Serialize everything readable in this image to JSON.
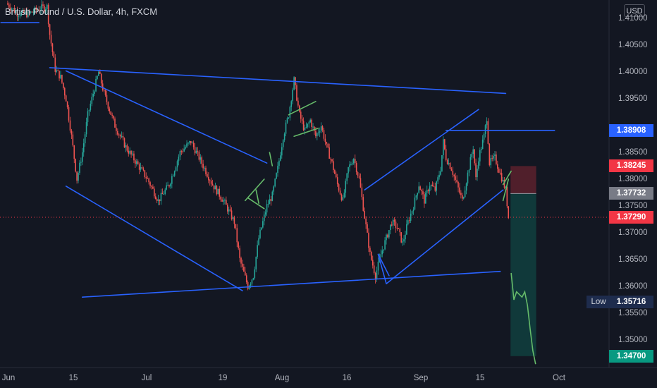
{
  "header": {
    "symbol_title": "British Pound / U.S. Dollar, 4h, FXCM",
    "currency_button": "USD"
  },
  "chart_data": {
    "type": "candlestick",
    "title": "British Pound / U.S. Dollar, 4h, FXCM",
    "x_tick_labels": [
      "Jun",
      "15",
      "Jul",
      "19",
      "Aug",
      "16",
      "Sep",
      "15",
      "Oct"
    ],
    "y_tick_labels": [
      "1.41000",
      "1.40500",
      "1.40000",
      "1.39500",
      "1.38500",
      "1.38000",
      "1.37500",
      "1.37000",
      "1.36500",
      "1.36000",
      "1.35500",
      "1.35000"
    ],
    "ylim": [
      1.3455,
      1.4135
    ],
    "grid": false,
    "price_labels": [
      {
        "id": "level",
        "value": "1.38908",
        "color": "#2962ff"
      },
      {
        "id": "stop",
        "value": "1.38245",
        "color": "#f23645"
      },
      {
        "id": "entry",
        "value": "1.37732",
        "color": "#787b86"
      },
      {
        "id": "last",
        "value": "1.37290",
        "color": "#f23645"
      },
      {
        "id": "low",
        "value": "1.35716",
        "color": "#1e2c4d",
        "tag": "Low"
      },
      {
        "id": "target",
        "value": "1.34700",
        "color": "#089981"
      }
    ],
    "price_path": [
      [
        0,
        1.4128
      ],
      [
        4,
        1.411
      ],
      [
        8,
        1.4108
      ],
      [
        12,
        1.4118
      ],
      [
        15,
        1.4122
      ],
      [
        16,
        1.407
      ],
      [
        18,
        1.4005
      ],
      [
        20,
        1.399
      ],
      [
        22,
        1.395
      ],
      [
        24,
        1.388
      ],
      [
        26,
        1.38
      ],
      [
        28,
        1.385
      ],
      [
        30,
        1.392
      ],
      [
        32,
        1.396
      ],
      [
        34,
        1.4
      ],
      [
        36,
        1.396
      ],
      [
        40,
        1.39
      ],
      [
        44,
        1.386
      ],
      [
        48,
        1.383
      ],
      [
        52,
        1.38
      ],
      [
        56,
        1.376
      ],
      [
        60,
        1.379
      ],
      [
        64,
        1.385
      ],
      [
        68,
        1.387
      ],
      [
        72,
        1.383
      ],
      [
        76,
        1.379
      ],
      [
        80,
        1.376
      ],
      [
        84,
        1.372
      ],
      [
        86,
        1.365
      ],
      [
        89,
        1.36
      ],
      [
        91,
        1.362
      ],
      [
        93,
        1.369
      ],
      [
        96,
        1.375
      ],
      [
        98,
        1.377
      ],
      [
        100,
        1.382
      ],
      [
        102,
        1.388
      ],
      [
        104,
        1.392
      ],
      [
        106,
        1.3985
      ],
      [
        108,
        1.392
      ],
      [
        110,
        1.389
      ],
      [
        112,
        1.391
      ],
      [
        114,
        1.388
      ],
      [
        116,
        1.39
      ],
      [
        118,
        1.386
      ],
      [
        120,
        1.383
      ],
      [
        122,
        1.379
      ],
      [
        124,
        1.376
      ],
      [
        126,
        1.382
      ],
      [
        128,
        1.384
      ],
      [
        130,
        1.38
      ],
      [
        132,
        1.373
      ],
      [
        134,
        1.366
      ],
      [
        136,
        1.362
      ],
      [
        138,
        1.366
      ],
      [
        140,
        1.369
      ],
      [
        142,
        1.372
      ],
      [
        144,
        1.371
      ],
      [
        146,
        1.368
      ],
      [
        148,
        1.372
      ],
      [
        150,
        1.375
      ],
      [
        152,
        1.379
      ],
      [
        154,
        1.376
      ],
      [
        156,
        1.379
      ],
      [
        158,
        1.378
      ],
      [
        160,
        1.382
      ],
      [
        161,
        1.387
      ],
      [
        162,
        1.384
      ],
      [
        164,
        1.382
      ],
      [
        166,
        1.379
      ],
      [
        168,
        1.376
      ],
      [
        170,
        1.381
      ],
      [
        172,
        1.386
      ],
      [
        173,
        1.38
      ],
      [
        174,
        1.384
      ],
      [
        176,
        1.388
      ],
      [
        177,
        1.3915
      ],
      [
        178,
        1.383
      ],
      [
        180,
        1.384
      ],
      [
        182,
        1.381
      ],
      [
        184,
        1.378
      ],
      [
        185,
        1.3729
      ]
    ],
    "projected_path": [
      [
        186,
        1.3625
      ],
      [
        187,
        1.3575
      ],
      [
        188,
        1.359
      ],
      [
        190,
        1.358
      ],
      [
        191,
        1.359
      ],
      [
        192,
        1.3565
      ],
      [
        193,
        1.352
      ],
      [
        194,
        1.348
      ],
      [
        195,
        1.3455
      ]
    ],
    "drawn_lines": [
      {
        "name": "top-left-level",
        "points": [
          [
            -2,
            1.4092
          ],
          [
            12,
            1.4092
          ]
        ],
        "color": "#2962ff"
      },
      {
        "name": "upper-trendline",
        "points": [
          [
            16,
            1.4008
          ],
          [
            184,
            1.396
          ]
        ],
        "color": "#2962ff"
      },
      {
        "name": "lower-trendline",
        "points": [
          [
            28,
            1.358
          ],
          [
            182,
            1.3628
          ]
        ],
        "color": "#2962ff"
      },
      {
        "name": "wedge-upper-edge",
        "points": [
          [
            22,
            1.4002
          ],
          [
            96,
            1.383
          ]
        ],
        "color": "#2962ff"
      },
      {
        "name": "wedge-lower-edge",
        "points": [
          [
            22,
            1.3787
          ],
          [
            87,
            1.3592
          ]
        ],
        "color": "#2962ff"
      },
      {
        "name": "resistance-level",
        "points": [
          [
            162,
            1.3891
          ],
          [
            202,
            1.3891
          ]
        ],
        "color": "#2962ff"
      },
      {
        "name": "channel-upper",
        "points": [
          [
            132,
            1.378
          ],
          [
            174,
            1.393
          ]
        ],
        "color": "#2962ff"
      },
      {
        "name": "channel-lower",
        "points": [
          [
            140,
            1.3605
          ],
          [
            183,
            1.378
          ]
        ],
        "color": "#2962ff"
      },
      {
        "name": "dip-line-a",
        "points": [
          [
            137,
            1.366
          ],
          [
            140,
            1.3605
          ]
        ],
        "color": "#2962ff"
      },
      {
        "name": "dip-line-b",
        "points": [
          [
            137,
            1.366
          ],
          [
            141,
            1.362
          ]
        ],
        "color": "#2962ff"
      },
      {
        "name": "flag-top",
        "points": [
          [
            104,
            1.392
          ],
          [
            114,
            1.3945
          ]
        ],
        "color": "#66bb6a"
      },
      {
        "name": "flag-bottom",
        "points": [
          [
            106,
            1.388
          ],
          [
            115,
            1.3895
          ]
        ],
        "color": "#66bb6a"
      },
      {
        "name": "pole-up",
        "points": [
          [
            88,
            1.376
          ],
          [
            95,
            1.38
          ]
        ],
        "color": "#66bb6a"
      },
      {
        "name": "pole-down",
        "points": [
          [
            89,
            1.3765
          ],
          [
            95,
            1.3745
          ]
        ],
        "color": "#66bb6a"
      },
      {
        "name": "mark-a",
        "points": [
          [
            92,
            1.378
          ],
          [
            93,
            1.3755
          ]
        ],
        "color": "#66bb6a"
      },
      {
        "name": "mark-b",
        "points": [
          [
            97,
            1.385
          ],
          [
            98,
            1.3825
          ]
        ],
        "color": "#66bb6a"
      },
      {
        "name": "right-flag-a",
        "points": [
          [
            183,
            1.379
          ],
          [
            186,
            1.3815
          ]
        ],
        "color": "#66bb6a"
      },
      {
        "name": "right-flag-b",
        "points": [
          [
            183,
            1.376
          ],
          [
            185,
            1.38
          ]
        ],
        "color": "#66bb6a"
      }
    ],
    "position_tool": {
      "x_range": [
        185,
        196
      ],
      "stop": 1.38245,
      "entry": 1.37732,
      "target": 1.347
    },
    "current_price_line": 1.3729
  }
}
